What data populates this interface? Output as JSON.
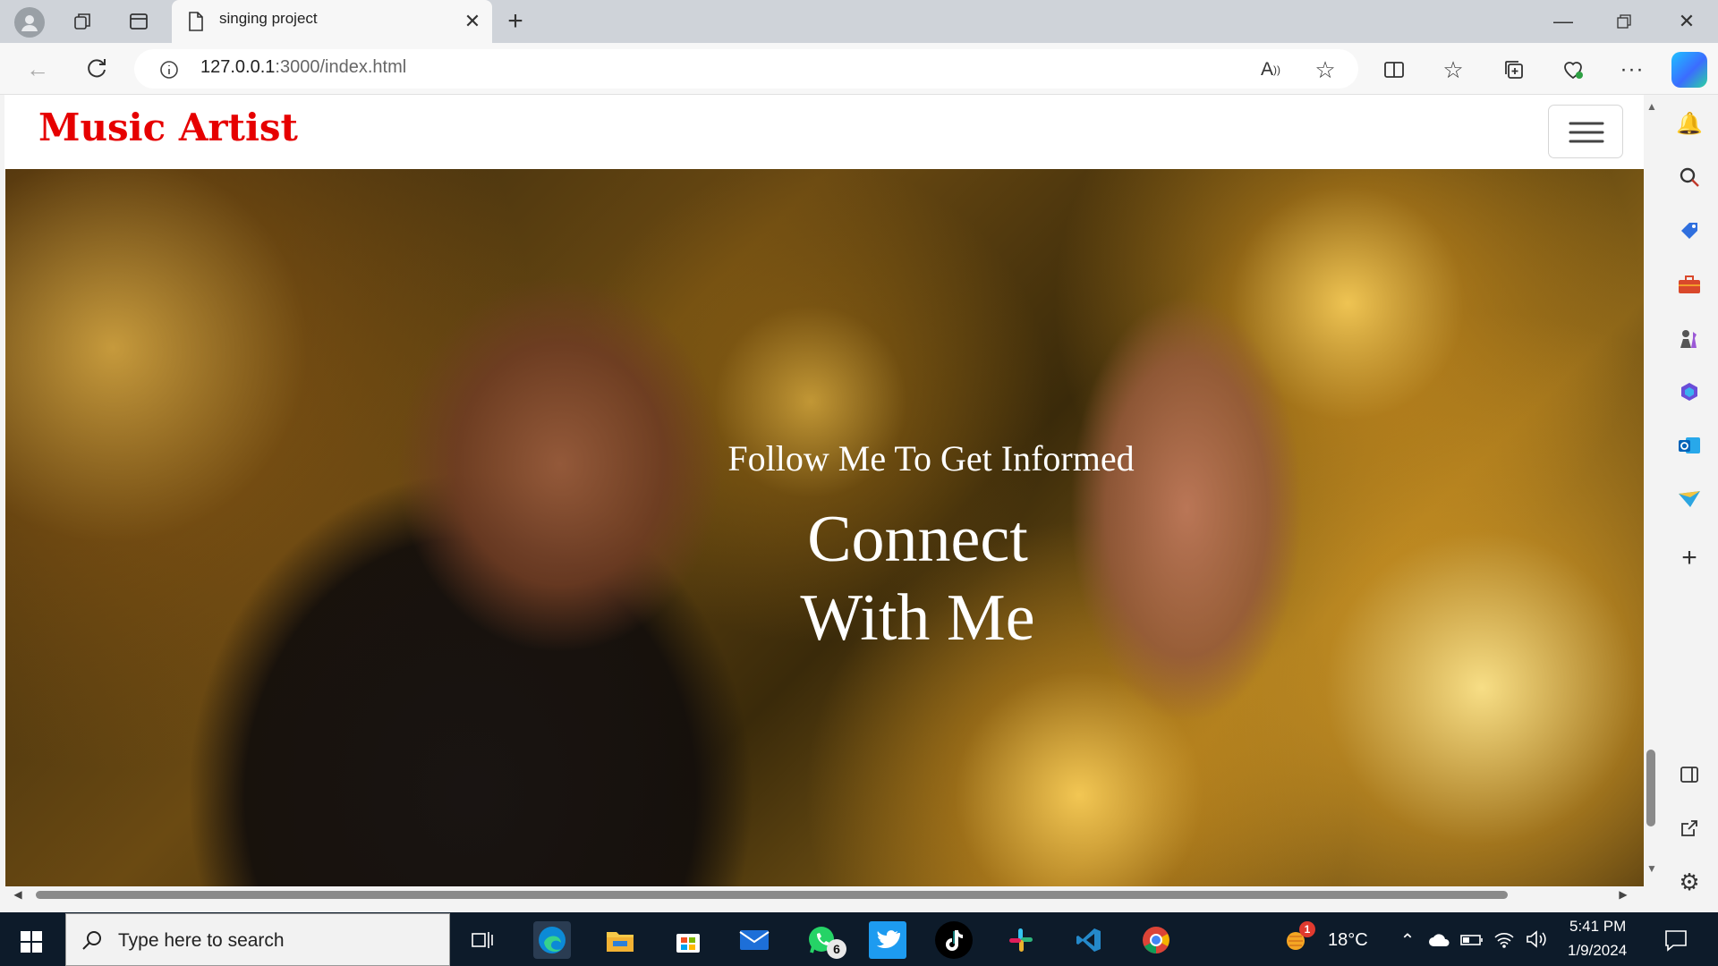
{
  "browser": {
    "tab_title": "singing project",
    "url_host": "127.0.0.1",
    "url_rest": ":3000/index.html"
  },
  "site": {
    "brand": "Music Artist",
    "hero_subtitle": "Follow Me To Get Informed",
    "hero_title_line1": "Connect",
    "hero_title_line2": "With Me"
  },
  "taskbar": {
    "search_placeholder": "Type here to search",
    "whatsapp_badge": "6",
    "weather_temp": "18°C",
    "weather_badge": "1",
    "time": "5:41 PM",
    "date": "1/9/2024"
  },
  "colors": {
    "brand": "#e60000",
    "taskbar_bg": "#0d1b2a"
  }
}
